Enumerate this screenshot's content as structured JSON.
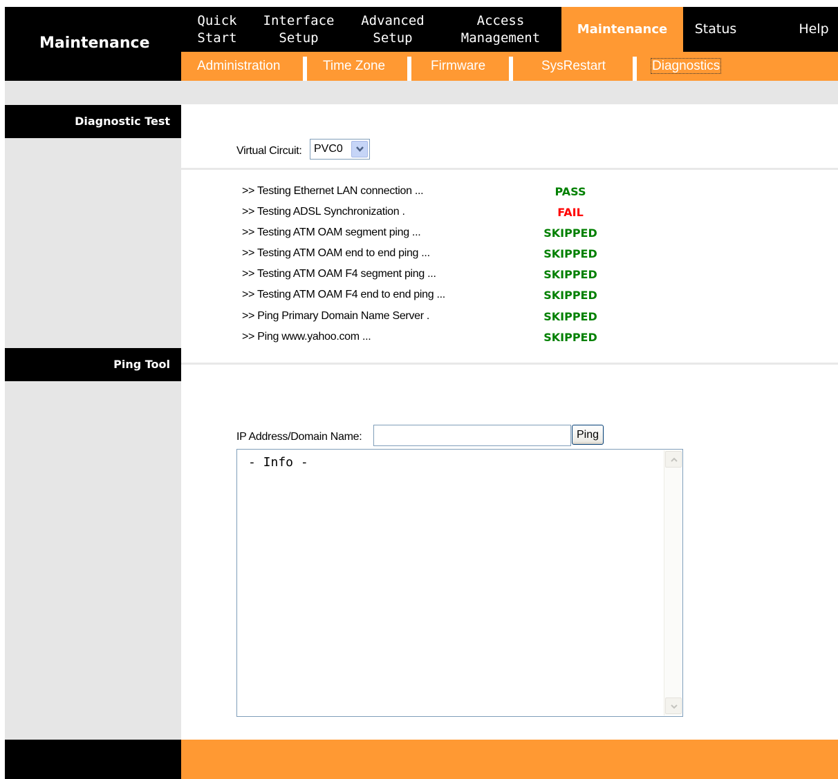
{
  "brand": {
    "title": "Maintenance"
  },
  "main_nav": [
    {
      "line1": "Quick",
      "line2": "Start"
    },
    {
      "line1": "Interface",
      "line2": "Setup"
    },
    {
      "line1": "Advanced",
      "line2": "Setup"
    },
    {
      "line1": "Access",
      "line2": "Management"
    },
    {
      "line1": "Maintenance",
      "line2": "",
      "active": true
    },
    {
      "line1": "Status",
      "line2": ""
    },
    {
      "line1": "Help",
      "line2": ""
    }
  ],
  "sub_nav": [
    "Administration",
    "Time Zone",
    "Firmware",
    "SysRestart",
    "Diagnostics"
  ],
  "diagnostic": {
    "section_title": "Diagnostic Test",
    "vc_label": "Virtual Circuit:",
    "vc_value": "PVC0",
    "tests": [
      {
        "name": ">> Testing Ethernet LAN connection ...",
        "result": "PASS"
      },
      {
        "name": ">> Testing ADSL Synchronization .",
        "result": "FAIL"
      },
      {
        "name": ">> Testing ATM OAM segment ping ...",
        "result": "SKIPPED"
      },
      {
        "name": ">> Testing ATM OAM end to end ping ...",
        "result": "SKIPPED"
      },
      {
        "name": ">> Testing ATM OAM F4 segment ping ...",
        "result": "SKIPPED"
      },
      {
        "name": ">> Testing ATM OAM F4 end to end ping ...",
        "result": "SKIPPED"
      },
      {
        "name": ">> Ping Primary Domain Name Server .",
        "result": "SKIPPED"
      },
      {
        "name": ">> Ping www.yahoo.com ...",
        "result": "SKIPPED"
      }
    ]
  },
  "ping": {
    "section_title": "Ping Tool",
    "ip_label": "IP Address/Domain Name:",
    "ip_value": "",
    "button": "Ping",
    "info_text": "- Info -"
  },
  "colors": {
    "orange": "#ff9933",
    "pass": "#008000",
    "fail": "#ff0000",
    "skipped": "#008000"
  }
}
